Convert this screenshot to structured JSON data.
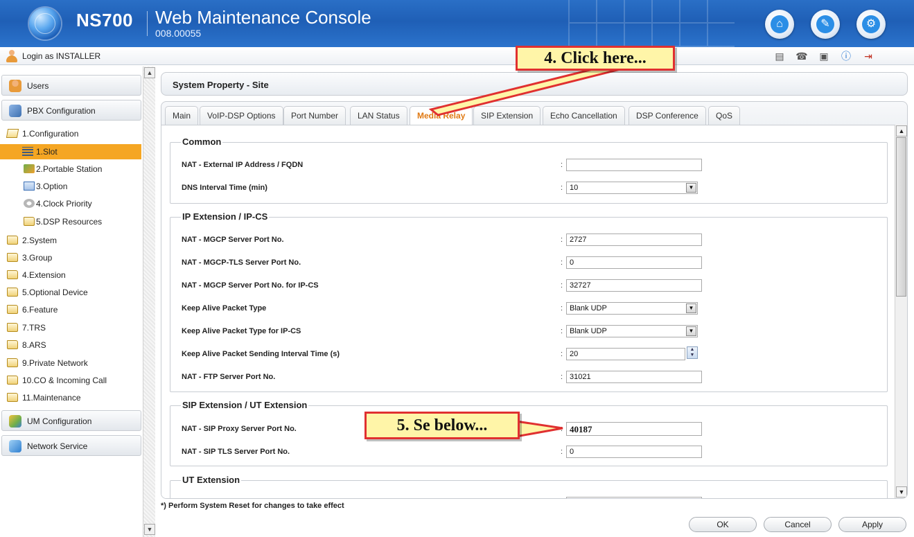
{
  "header": {
    "brand": "NS700",
    "title": "Web Maintenance Console",
    "version": "008.00055"
  },
  "loginbar": {
    "text": "Login as INSTALLER"
  },
  "sidebar": {
    "sections": [
      {
        "label": "Users"
      },
      {
        "label": "PBX Configuration"
      },
      {
        "label": "UM Configuration"
      },
      {
        "label": "Network Service"
      }
    ],
    "tree": [
      {
        "label": "1.Configuration"
      },
      {
        "label": "1.Slot"
      },
      {
        "label": "2.Portable Station"
      },
      {
        "label": "3.Option"
      },
      {
        "label": "4.Clock Priority"
      },
      {
        "label": "5.DSP Resources"
      },
      {
        "label": "2.System"
      },
      {
        "label": "3.Group"
      },
      {
        "label": "4.Extension"
      },
      {
        "label": "5.Optional Device"
      },
      {
        "label": "6.Feature"
      },
      {
        "label": "7.TRS"
      },
      {
        "label": "8.ARS"
      },
      {
        "label": "9.Private Network"
      },
      {
        "label": "10.CO & Incoming Call"
      },
      {
        "label": "11.Maintenance"
      }
    ]
  },
  "page": {
    "title": "System Property - Site"
  },
  "tabs": [
    "Main",
    "VoIP-DSP Options",
    "Port Number",
    "LAN Status",
    "Media Relay",
    "SIP Extension",
    "Echo Cancellation",
    "DSP Conference",
    "QoS"
  ],
  "groups": {
    "common": {
      "title": "Common",
      "rows": [
        {
          "label": "NAT - External IP Address / FQDN",
          "value": ""
        },
        {
          "label": "DNS Interval Time (min)",
          "value": "10"
        }
      ]
    },
    "ip_ext": {
      "title": "IP Extension / IP-CS",
      "rows": [
        {
          "label": "NAT - MGCP Server Port No.",
          "value": "2727"
        },
        {
          "label": "NAT - MGCP-TLS Server Port No.",
          "value": "0"
        },
        {
          "label": "NAT - MGCP Server Port No. for IP-CS",
          "value": "32727"
        },
        {
          "label": "Keep Alive Packet Type",
          "value": "Blank UDP"
        },
        {
          "label": "Keep Alive Packet Type for IP-CS",
          "value": "Blank UDP"
        },
        {
          "label": "Keep Alive Packet Sending Interval Time (s)",
          "value": "20"
        },
        {
          "label": "NAT - FTP Server Port No.",
          "value": "31021"
        }
      ]
    },
    "sip_ext": {
      "title": "SIP Extension / UT Extension",
      "rows": [
        {
          "label": "NAT - SIP Proxy Server Port No.",
          "value": "40187"
        },
        {
          "label": "NAT - SIP TLS Server Port No.",
          "value": "0"
        }
      ]
    },
    "ut_ext": {
      "title": "UT Extension"
    }
  },
  "footer": {
    "note": "*) Perform System Reset for changes to take effect",
    "ok": "OK",
    "cancel": "Cancel",
    "apply": "Apply"
  },
  "annotations": {
    "click_here": "4. Click here...",
    "see_below": "5. Se below..."
  },
  "colors": {
    "header_blue": "#1f5fb6",
    "active_tab": "#e07a14",
    "active_tree": "#f5a623",
    "callout_fill": "#fff5a8",
    "callout_border": "#e03030"
  }
}
